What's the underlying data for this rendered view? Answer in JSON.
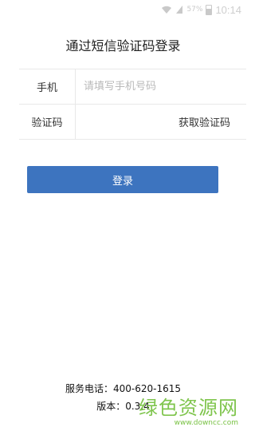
{
  "status_bar": {
    "battery_percent": "57%",
    "battery_level": 0.57,
    "time": "10:14",
    "icons": [
      "wifi-icon",
      "signal-icon",
      "battery-icon"
    ]
  },
  "page": {
    "title": "通过短信验证码登录"
  },
  "form": {
    "phone_label": "手机",
    "phone_placeholder": "请填写手机号码",
    "phone_value": "",
    "code_label": "验证码",
    "code_value": "",
    "get_code_label": "获取验证码"
  },
  "login_button": {
    "label": "登录",
    "color": "#3d74bf"
  },
  "footer": {
    "phone": "服务电话：400-620-1615",
    "version": "版本：0.3.4"
  },
  "watermark": {
    "brand": "绿色资源网",
    "url": "www.downcc.com",
    "color": "#79c244"
  }
}
